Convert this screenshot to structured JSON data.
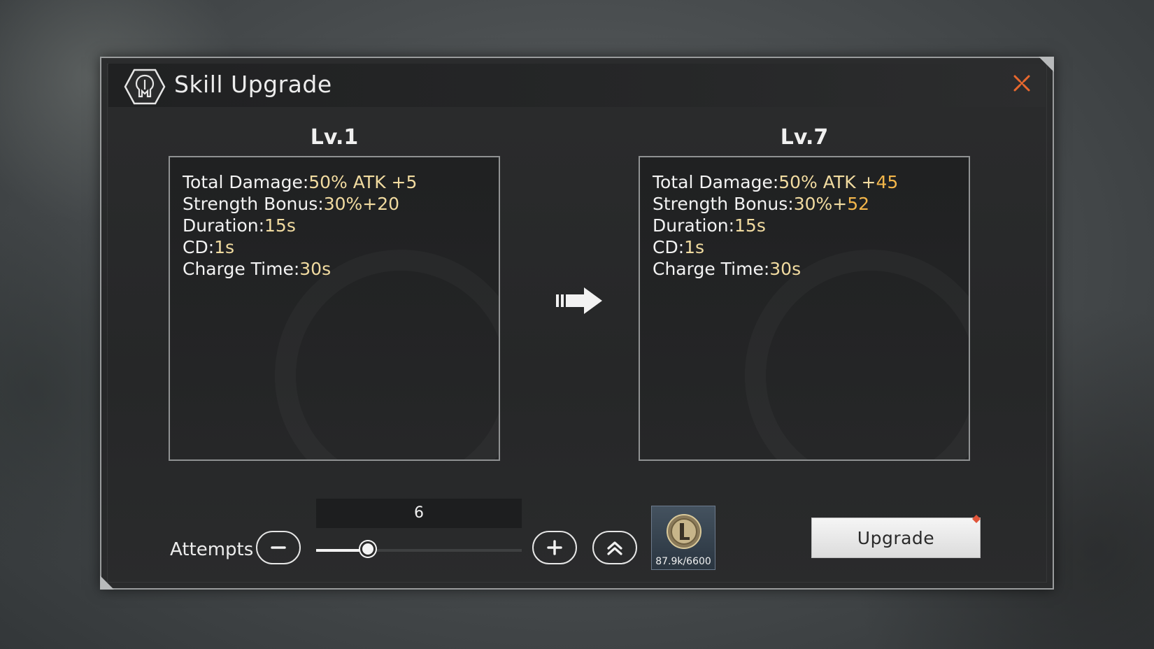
{
  "dialog": {
    "title": "Skill Upgrade",
    "title_icon": "skill-tree-icon",
    "close_icon": "close-icon"
  },
  "current": {
    "level": "Lv.1",
    "stats": [
      {
        "label": "Total Damage:",
        "base": "50% ATK +",
        "value": "5"
      },
      {
        "label": "Strength Bonus:",
        "base": "30%+",
        "value": "20"
      },
      {
        "label": "Duration:",
        "base": "",
        "value": "15s"
      },
      {
        "label": "CD:",
        "base": "",
        "value": "1s"
      },
      {
        "label": "Charge Time:",
        "base": "",
        "value": "30s"
      }
    ]
  },
  "next": {
    "level": "Lv.7",
    "stats": [
      {
        "label": "Total Damage:",
        "base": "50% ATK +",
        "value": "45"
      },
      {
        "label": "Strength Bonus:",
        "base": "30%+",
        "value": "52"
      },
      {
        "label": "Duration:",
        "base": "",
        "value": "15s"
      },
      {
        "label": "CD:",
        "base": "",
        "value": "1s"
      },
      {
        "label": "Charge Time:",
        "base": "",
        "value": "30s"
      }
    ]
  },
  "attempts": {
    "label": "Attempts",
    "count": "6",
    "slider_fraction": 0.25,
    "minus_icon": "minus-icon",
    "plus_icon": "plus-icon",
    "max_icon": "double-chevron-up-icon"
  },
  "cost_item": {
    "icon": "coin-icon",
    "quantity": "87.9k/6600"
  },
  "upgrade_button": {
    "label": "Upgrade",
    "badge_color": "#e0553a"
  },
  "colors": {
    "highlight_value": "#f3b64a",
    "normal_value": "#f1dba0",
    "close_accent": "#e8682e"
  }
}
